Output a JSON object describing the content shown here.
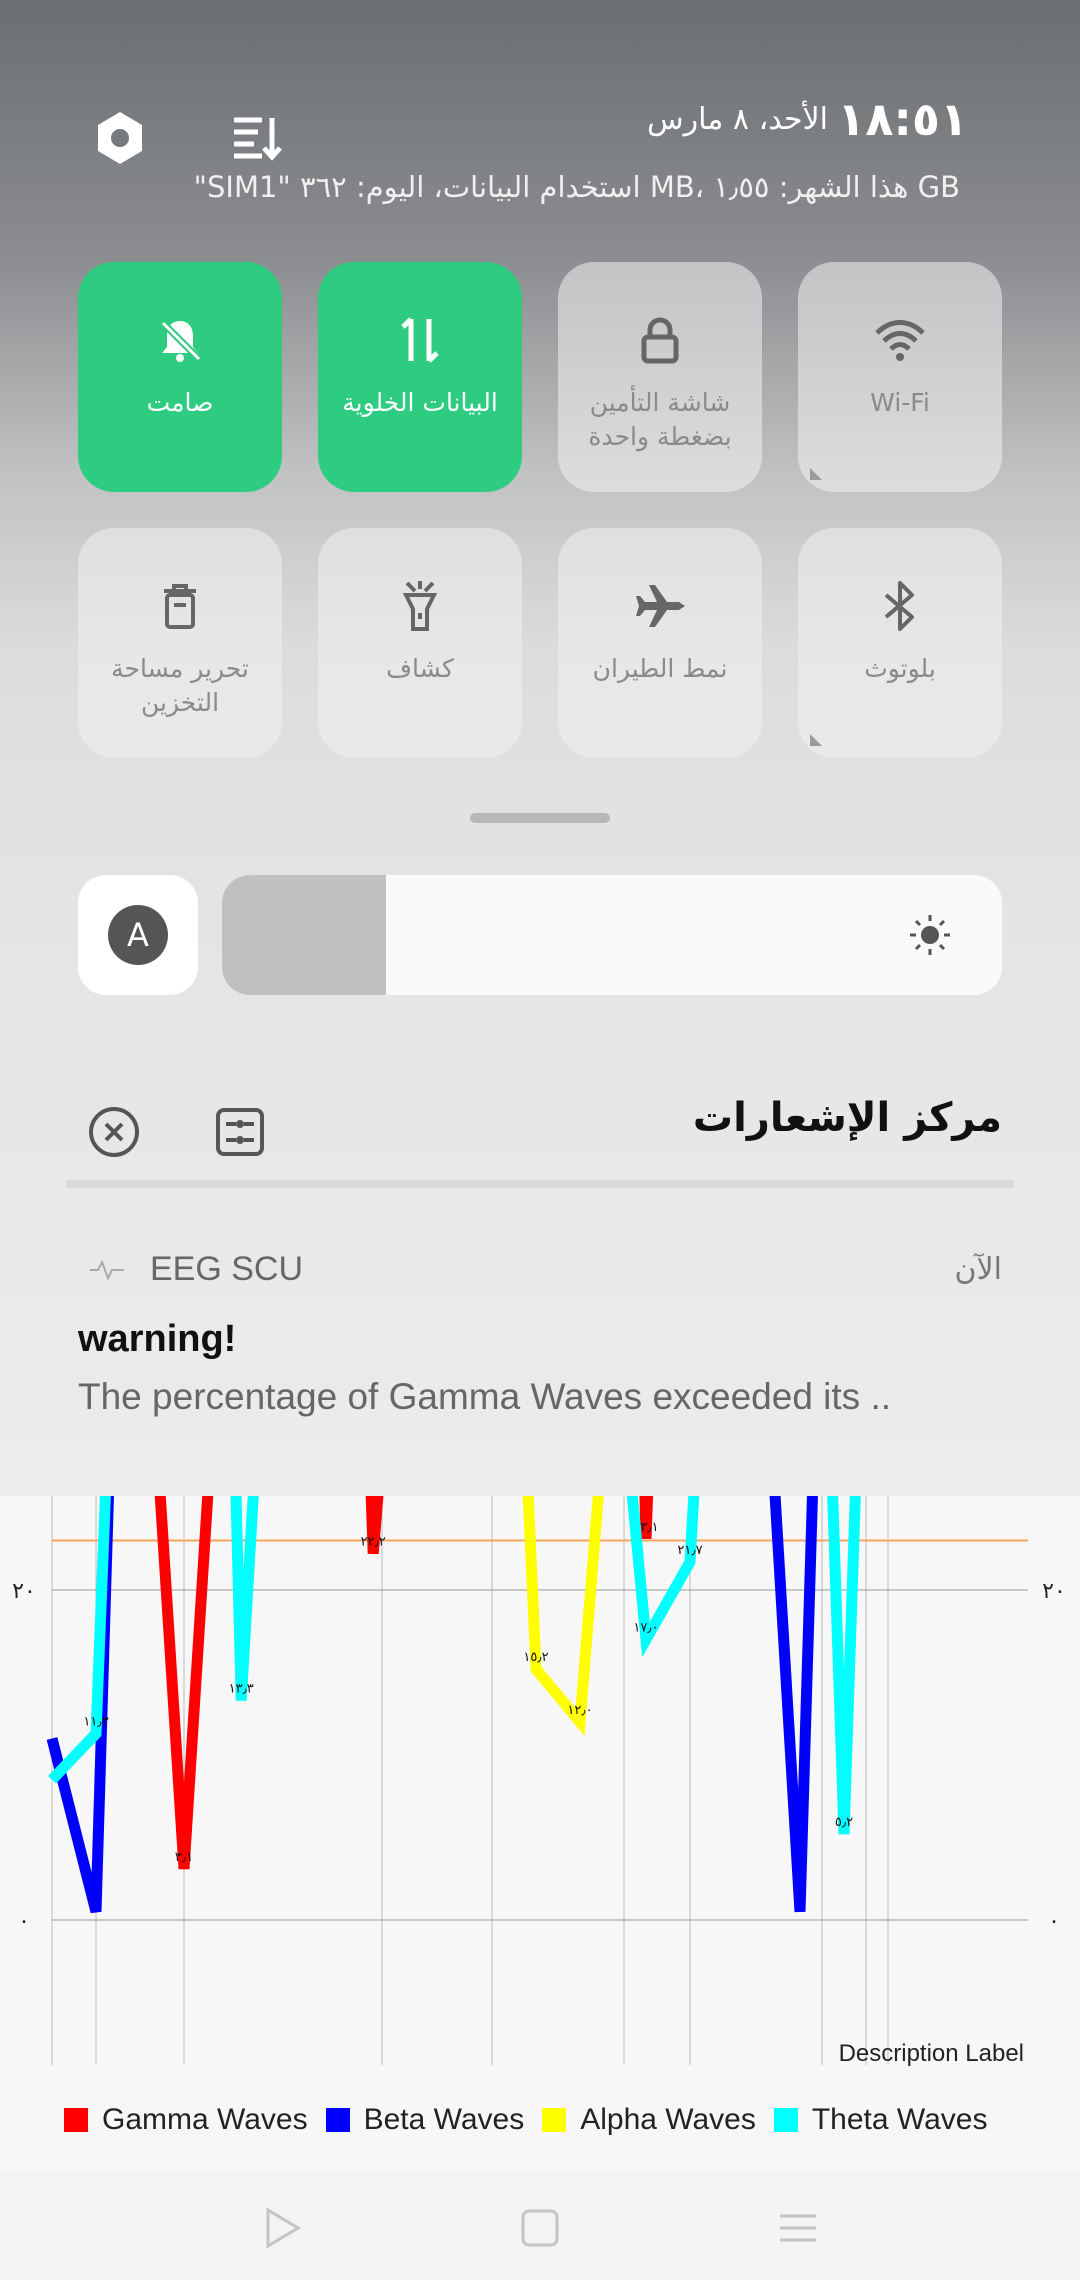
{
  "status": {
    "time": "١٨:٥١",
    "date": "الأحد، ٨ مارس",
    "data_usage": "\"SIM1\" استخدام البيانات، اليوم: ٣٦٢ MB، هذا الشهر: ١٫٥٥ GB"
  },
  "icons": {
    "settings": "gear-icon",
    "edit": "edit-tiles-icon"
  },
  "quick_tiles": [
    {
      "label": "صامت",
      "icon": "bell-off-icon",
      "active": true
    },
    {
      "label": "البيانات الخلوية",
      "icon": "mobile-data-icon",
      "active": true
    },
    {
      "label": "شاشة التأمين بضغطة واحدة",
      "icon": "lock-icon",
      "active": false
    },
    {
      "label": "Wi-Fi",
      "icon": "wifi-icon",
      "active": false
    },
    {
      "label": "تحرير مساحة التخزين",
      "icon": "trash-icon",
      "active": false
    },
    {
      "label": "كشاف",
      "icon": "flashlight-icon",
      "active": false
    },
    {
      "label": "نمط الطيران",
      "icon": "airplane-icon",
      "active": false
    },
    {
      "label": "بلوتوث",
      "icon": "bluetooth-icon",
      "active": false
    }
  ],
  "brightness": {
    "auto_label": "A",
    "level": 0.21
  },
  "notification_center": {
    "title": "مركز الإشعارات"
  },
  "notification": {
    "app_name": "EEG SCU",
    "time": "الآن",
    "title": "warning!",
    "body": "The percentage of Gamma Waves exceeded its .."
  },
  "colors": {
    "tile_active": "#2ecc80",
    "gamma": "#ff0000",
    "beta": "#0000ff",
    "alpha": "#ffff00",
    "theta": "#00ffff",
    "limit_line": "#f4a460"
  },
  "chart_data": {
    "type": "line",
    "description_label": "Description Label",
    "y_tick_labels": [
      "٢٠",
      "٠"
    ],
    "y_ticks": [
      20,
      0
    ],
    "legend": [
      "Gamma Waves",
      "Beta Waves",
      "Alpha Waves",
      "Theta Waves"
    ],
    "limit_line": 23,
    "series": [
      {
        "name": "Gamma Waves",
        "color": "#ff0000",
        "points": [
          [
            2.0,
            45
          ],
          [
            3.0,
            3.1
          ],
          [
            4.0,
            45
          ],
          [
            7.0,
            45
          ],
          [
            7.3,
            22.2
          ],
          [
            8.0,
            45
          ],
          [
            13.3,
            45
          ],
          [
            13.5,
            23.1
          ],
          [
            13.8,
            45
          ]
        ],
        "labels": [
          {
            "x": 3.0,
            "y": 3.1,
            "text": "٣٫١"
          },
          {
            "x": 7.3,
            "y": 22.2,
            "text": "٢٢٫٢"
          },
          {
            "x": 13.5,
            "y": 23.1,
            "text": "٢٣٫١"
          }
        ]
      },
      {
        "name": "Beta Waves",
        "color": "#0000ff",
        "points": [
          [
            0.0,
            11.0
          ],
          [
            1.0,
            0.5
          ],
          [
            1.5,
            45
          ],
          [
            16.0,
            45
          ],
          [
            17.0,
            0.5
          ],
          [
            17.5,
            45
          ]
        ],
        "labels": [
          {
            "x": 1.0,
            "y": 0.5,
            "text": "٠"
          },
          {
            "x": 17.0,
            "y": 0.5,
            "text": "٠"
          }
        ]
      },
      {
        "name": "Alpha Waves",
        "color": "#ffff00",
        "points": [
          [
            10.5,
            45
          ],
          [
            11.0,
            15.2
          ],
          [
            12.0,
            12.0
          ],
          [
            13.0,
            45
          ]
        ],
        "labels": [
          {
            "x": 11.0,
            "y": 15.2,
            "text": "١٥٫٢"
          },
          {
            "x": 12.0,
            "y": 12.0,
            "text": "١٢٫٠"
          }
        ]
      },
      {
        "name": "Theta Waves",
        "color": "#00ffff",
        "points": [
          [
            0.0,
            8.5
          ],
          [
            1.0,
            11.3
          ],
          [
            1.5,
            45
          ],
          [
            4.0,
            45
          ],
          [
            4.3,
            13.3
          ],
          [
            5.0,
            45
          ],
          [
            12.5,
            45
          ],
          [
            13.5,
            17.0
          ],
          [
            14.5,
            21.7
          ],
          [
            15.0,
            45
          ],
          [
            17.5,
            45
          ],
          [
            18.0,
            5.2
          ],
          [
            18.5,
            45
          ]
        ],
        "labels": [
          {
            "x": 1.0,
            "y": 11.3,
            "text": "١١٫٣"
          },
          {
            "x": 4.3,
            "y": 13.3,
            "text": "١٣٫٣"
          },
          {
            "x": 13.5,
            "y": 17.0,
            "text": "١٧٫٠"
          },
          {
            "x": 14.5,
            "y": 21.7,
            "text": "٢١٫٧"
          },
          {
            "x": 18.0,
            "y": 5.2,
            "text": "٥٫٢"
          }
        ]
      }
    ]
  },
  "navbar": {
    "back": "play-triangle-icon",
    "home": "square-icon",
    "menu": "menu-lines-icon"
  }
}
